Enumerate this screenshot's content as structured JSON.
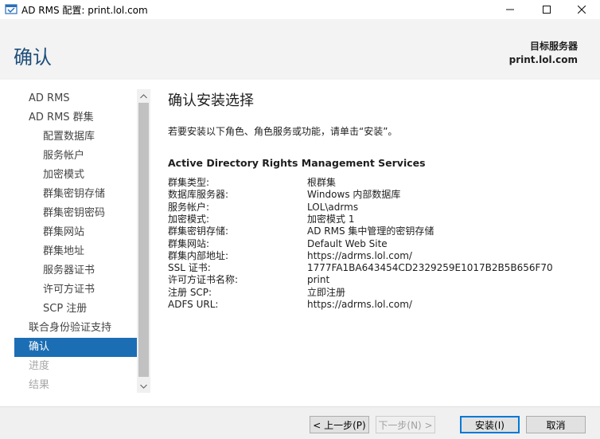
{
  "window": {
    "title": "AD RMS 配置: print.lol.com",
    "minimize_glyph": "─",
    "maximize_glyph": "☐",
    "close_glyph": "✕"
  },
  "header": {
    "title": "确认",
    "destination_label": "目标服务器",
    "destination_value": "print.lol.com"
  },
  "sidebar": {
    "items": [
      {
        "label": "AD RMS",
        "level": 0,
        "state": "normal"
      },
      {
        "label": "AD RMS 群集",
        "level": 0,
        "state": "normal"
      },
      {
        "label": "配置数据库",
        "level": 1,
        "state": "normal"
      },
      {
        "label": "服务帐户",
        "level": 1,
        "state": "normal"
      },
      {
        "label": "加密模式",
        "level": 1,
        "state": "normal"
      },
      {
        "label": "群集密钥存储",
        "level": 1,
        "state": "normal"
      },
      {
        "label": "群集密钥密码",
        "level": 1,
        "state": "normal"
      },
      {
        "label": "群集网站",
        "level": 1,
        "state": "normal"
      },
      {
        "label": "群集地址",
        "level": 1,
        "state": "normal"
      },
      {
        "label": "服务器证书",
        "level": 1,
        "state": "normal"
      },
      {
        "label": "许可方证书",
        "level": 1,
        "state": "normal"
      },
      {
        "label": "SCP 注册",
        "level": 1,
        "state": "normal"
      },
      {
        "label": "联合身份验证支持",
        "level": 0,
        "state": "normal"
      },
      {
        "label": "确认",
        "level": 0,
        "state": "active"
      },
      {
        "label": "进度",
        "level": 0,
        "state": "disabled"
      },
      {
        "label": "结果",
        "level": 0,
        "state": "disabled"
      }
    ]
  },
  "main": {
    "section_title": "确认安装选择",
    "instructions": "若要安装以下角色、角色服务或功能，请单击“安装”。",
    "role_title": "Active Directory Rights Management Services",
    "details": [
      {
        "key": "群集类型:",
        "value": "根群集"
      },
      {
        "key": "数据库服务器:",
        "value": "Windows 内部数据库"
      },
      {
        "key": "服务帐户:",
        "value": "LOL\\adrms"
      },
      {
        "key": "加密模式:",
        "value": "加密模式 1"
      },
      {
        "key": "群集密钥存储:",
        "value": "AD RMS 集中管理的密钥存储"
      },
      {
        "key": "群集网站:",
        "value": "Default Web Site"
      },
      {
        "key": "群集内部地址:",
        "value": "https://adrms.lol.com/"
      },
      {
        "key": "SSL 证书:",
        "value": "1777FA1BA643454CD2329259E1017B2B5B656F70"
      },
      {
        "key": "许可方证书名称:",
        "value": "print"
      },
      {
        "key": "注册 SCP:",
        "value": "立即注册"
      },
      {
        "key": "ADFS URL:",
        "value": "https://adrms.lol.com/"
      }
    ]
  },
  "footer": {
    "back_label": "< 上一步(P)",
    "next_label": "下一步(N) >",
    "install_label": "安装(I)",
    "cancel_label": "取消"
  },
  "colors": {
    "accent": "#1c6eb4",
    "title_blue": "#1e4e79"
  }
}
